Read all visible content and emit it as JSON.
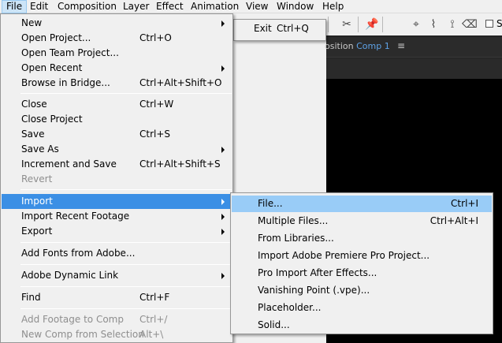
{
  "menubar": {
    "items": [
      {
        "label": "File",
        "active": true
      },
      {
        "label": "Edit"
      },
      {
        "label": "Composition"
      },
      {
        "label": "Layer"
      },
      {
        "label": "Effect"
      },
      {
        "label": "Animation"
      },
      {
        "label": "View"
      },
      {
        "label": "Window"
      },
      {
        "label": "Help"
      }
    ]
  },
  "background": {
    "composition_label": "osition",
    "composition_name": "Comp 1",
    "panel_menu_icon": "hamburger-icon",
    "toolbar_icons": [
      "text-tool-icon",
      "brush-tool-icon",
      "clone-stamp-icon",
      "eraser-icon",
      "roto-brush-icon",
      "puppet-pin-icon"
    ],
    "toolbar_checkbox_label": "S"
  },
  "file_menu": {
    "items": [
      {
        "label": "New",
        "submenu": true
      },
      {
        "label": "Open Project...",
        "shortcut": "Ctrl+O"
      },
      {
        "label": "Open Team Project..."
      },
      {
        "label": "Open Recent",
        "submenu": true
      },
      {
        "label": "Browse in Bridge...",
        "shortcut": "Ctrl+Alt+Shift+O"
      },
      {
        "separator": true
      },
      {
        "label": "Close",
        "shortcut": "Ctrl+W"
      },
      {
        "label": "Close Project"
      },
      {
        "label": "Save",
        "shortcut": "Ctrl+S"
      },
      {
        "label": "Save As",
        "submenu": true
      },
      {
        "label": "Increment and Save",
        "shortcut": "Ctrl+Alt+Shift+S"
      },
      {
        "label": "Revert",
        "disabled": true
      },
      {
        "separator": true
      },
      {
        "label": "Import",
        "submenu": true,
        "highlighted": true
      },
      {
        "label": "Import Recent Footage",
        "submenu": true
      },
      {
        "label": "Export",
        "submenu": true
      },
      {
        "separator": true
      },
      {
        "label": "Add Fonts from Adobe..."
      },
      {
        "separator": true
      },
      {
        "label": "Adobe Dynamic Link",
        "submenu": true
      },
      {
        "separator": true
      },
      {
        "label": "Find",
        "shortcut": "Ctrl+F"
      },
      {
        "separator": true
      },
      {
        "label": "Add Footage to Comp",
        "shortcut": "Ctrl+/",
        "disabled": true
      },
      {
        "label": "New Comp from Selection",
        "shortcut": "Alt+\\",
        "disabled": true
      }
    ]
  },
  "exit_item": {
    "label": "Exit",
    "shortcut": "Ctrl+Q"
  },
  "import_menu": {
    "items": [
      {
        "label": "File...",
        "shortcut": "Ctrl+I",
        "hover": true
      },
      {
        "label": "Multiple Files...",
        "shortcut": "Ctrl+Alt+I"
      },
      {
        "label": "From Libraries..."
      },
      {
        "label": "Import Adobe Premiere Pro Project..."
      },
      {
        "label": "Pro Import After Effects..."
      },
      {
        "label": "Vanishing Point (.vpe)..."
      },
      {
        "label": "Placeholder..."
      },
      {
        "label": "Solid..."
      }
    ]
  },
  "colors": {
    "menu_bg": "#f0f0f0",
    "highlight": "#3b8fe5",
    "hover": "#99ccf7",
    "disabled_text": "#8e8e8e",
    "accent_blue": "#5ea2e6"
  }
}
